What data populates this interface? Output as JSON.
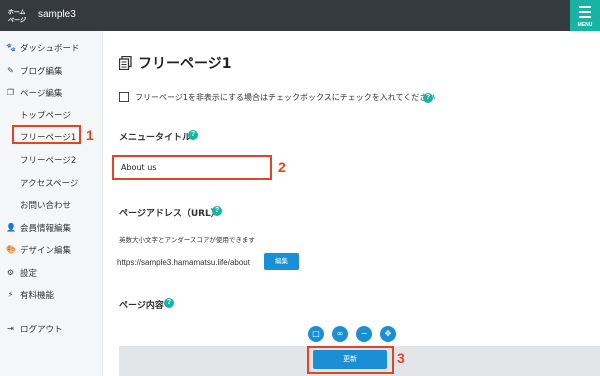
{
  "header": {
    "site_name": "sample3",
    "menu_label": "MENU",
    "logo_text": "ホームページ"
  },
  "sidebar": {
    "items": [
      {
        "label": "ダッシュボード",
        "icon": "paw-icon"
      },
      {
        "label": "ブログ編集",
        "icon": "pencil-icon"
      },
      {
        "label": "ページ編集",
        "icon": "copy-icon"
      },
      {
        "label": "トップページ",
        "icon": ""
      },
      {
        "label": "フリーページ1",
        "icon": ""
      },
      {
        "label": "フリーページ2",
        "icon": ""
      },
      {
        "label": "アクセスページ",
        "icon": ""
      },
      {
        "label": "お問い合わせ",
        "icon": ""
      },
      {
        "label": "会員情報編集",
        "icon": "user-icon"
      },
      {
        "label": "デザイン編集",
        "icon": "palette-icon"
      },
      {
        "label": "設定",
        "icon": "gear-icon"
      },
      {
        "label": "有料機能",
        "icon": "bolt-icon"
      },
      {
        "label": "ログアウト",
        "icon": "logout-icon"
      }
    ]
  },
  "main": {
    "page_title": "フリーページ1",
    "hide_checkbox_label": "フリーページ1を非表示にする場合はチェックボックスにチェックを入れてください",
    "menu_title_label": "メニュータイトル",
    "menu_title_value": "About us",
    "page_address_label": "ページアドレス（URL）",
    "page_address_hint": "英数大小文字とアンダースコアが使用できます",
    "page_url": "https://sample3.hamamatsu.life/about",
    "edit_button": "編集",
    "page_content_label": "ページ内容",
    "update_button": "更新"
  },
  "annotations": [
    "1",
    "2",
    "3"
  ],
  "colors": {
    "topbar": "#343a3f",
    "accent_teal": "#17b3a3",
    "button_blue": "#1b8fd6",
    "highlight_red": "#e0442a"
  }
}
